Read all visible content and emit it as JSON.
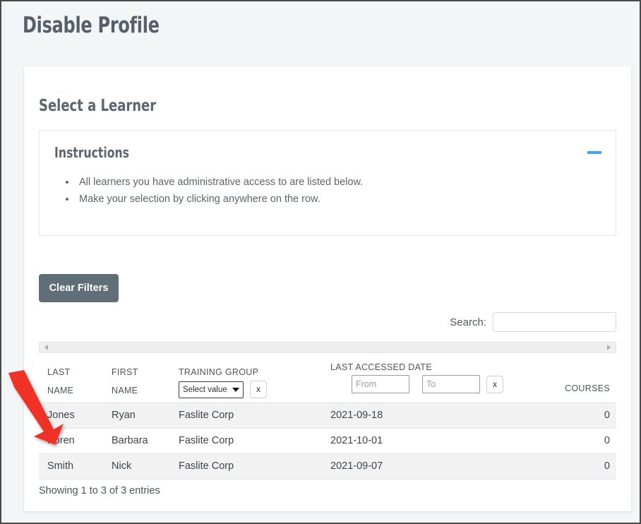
{
  "page": {
    "title": "Disable Profile"
  },
  "section": {
    "title": "Select a Learner"
  },
  "instructions": {
    "title": "Instructions",
    "collapse_icon": "minus-icon",
    "collapse_color": "#44a3ee",
    "items": [
      "All learners you have administrative access to are listed below.",
      "Make your selection by clicking anywhere on the row."
    ]
  },
  "toolbar": {
    "clear_filters_label": "Clear Filters",
    "clear_filters_color": "#606e78"
  },
  "search": {
    "label": "Search:",
    "value": "",
    "placeholder": ""
  },
  "scrollbar": {
    "left_arrow_icon": "triangle-left-icon",
    "right_arrow_icon": "triangle-right-icon"
  },
  "table": {
    "headers": {
      "last_name_line1": "LAST",
      "last_name_line2": "NAME",
      "first_name_line1": "FIRST",
      "first_name_line2": "NAME",
      "training_group": "TRAINING GROUP",
      "last_accessed_date": "LAST ACCESSED DATE",
      "courses": "COURSES"
    },
    "filters": {
      "training_group_selected": "Select value",
      "training_group_options": [
        "Select value"
      ],
      "training_group_clear_label": "x",
      "date_from_placeholder": "From",
      "date_from_value": "",
      "date_to_placeholder": "To",
      "date_to_value": "",
      "date_clear_label": "x"
    },
    "rows": [
      {
        "last_name": "Jones",
        "first_name": "Ryan",
        "training_group": "Faslite Corp",
        "last_accessed_date": "2021-09-18",
        "courses": "0"
      },
      {
        "last_name": "Koren",
        "first_name": "Barbara",
        "training_group": "Faslite Corp",
        "last_accessed_date": "2021-10-01",
        "courses": "0"
      },
      {
        "last_name": "Smith",
        "first_name": "Nick",
        "training_group": "Faslite Corp",
        "last_accessed_date": "2021-09-07",
        "courses": "0"
      }
    ],
    "info": "Showing 1 to 3 of 3 entries"
  },
  "annotation": {
    "arrow_icon": "red-arrow-icon",
    "color": "#f03027"
  }
}
